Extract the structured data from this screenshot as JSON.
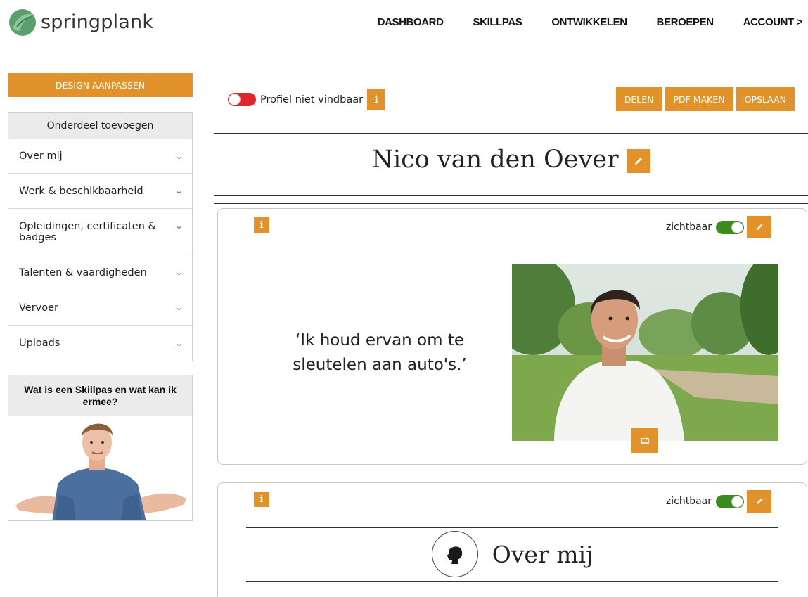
{
  "brand": {
    "name": "springplank",
    "accent": "#e1922a",
    "logo_green": "#5aa06c"
  },
  "nav": [
    {
      "label": "DASHBOARD"
    },
    {
      "label": "SKILLPAS"
    },
    {
      "label": "ONTWIKKELEN"
    },
    {
      "label": "BEROEPEN"
    },
    {
      "label": "ACCOUNT >"
    }
  ],
  "sidebar": {
    "design_button": "DESIGN AANPASSEN",
    "add_section_title": "Onderdeel toevoegen",
    "items": [
      {
        "label": "Over mij"
      },
      {
        "label": "Werk & beschikbaarheid"
      },
      {
        "label": "Opleidingen, certificaten & badges"
      },
      {
        "label": "Talenten & vaardigheden"
      },
      {
        "label": "Vervoer"
      },
      {
        "label": "Uploads"
      }
    ],
    "info_card_title": "Wat is een Skillpas en wat kan ik ermee?"
  },
  "toolbar": {
    "profile_visibility_label": "Profiel niet vindbaar",
    "profile_visible": false,
    "share_label": "DELEN",
    "pdf_label": "PDF MAKEN",
    "save_label": "OPSLAAN"
  },
  "profile": {
    "name": "Nico van den Oever"
  },
  "cards": [
    {
      "visibility_label": "zichtbaar",
      "visible": true,
      "quote": "‘Ik houd ervan om te sleutelen aan auto's.’"
    },
    {
      "visibility_label": "zichtbaar",
      "visible": true,
      "section_title": "Over mij",
      "icon": "head-profile-icon"
    }
  ],
  "icons": {
    "info": "info-icon",
    "edit": "pencil-icon",
    "chevron": "chevron-down-icon",
    "swap_photo": "swap-photo-icon"
  }
}
